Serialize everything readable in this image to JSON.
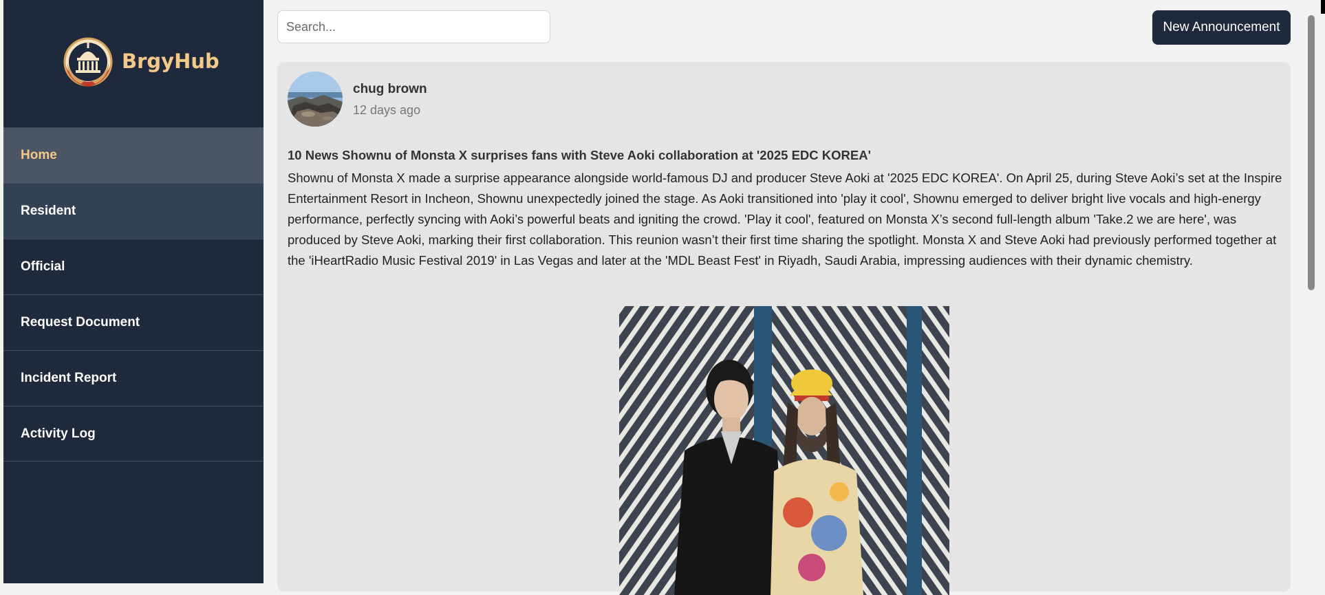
{
  "brand": {
    "name": "BrgyHub",
    "logo_icon": "capitol-building-logo-icon"
  },
  "sidebar": {
    "items": [
      {
        "label": "Home",
        "active": true
      },
      {
        "label": "Resident"
      },
      {
        "label": "Official"
      },
      {
        "label": "Request Document"
      },
      {
        "label": "Incident Report"
      },
      {
        "label": "Activity Log"
      }
    ]
  },
  "search": {
    "placeholder": "Search..."
  },
  "toolbar": {
    "new_announcement_label": "New Announcement"
  },
  "post": {
    "author": "chug brown",
    "time_ago": "12 days ago",
    "title": "10 News Shownu of Monsta X surprises fans with Steve Aoki collaboration at '2025 EDC KOREA'",
    "body": "Shownu of Monsta X made a surprise appearance alongside world-famous DJ and producer Steve Aoki at '2025 EDC KOREA'. On April 25, during Steve Aoki’s set at the Inspire Entertainment Resort in Incheon, Shownu unexpectedly joined the stage. As Aoki transitioned into 'play it cool', Shownu emerged to deliver bright live vocals and high-energy performance, perfectly syncing with Aoki’s powerful beats and igniting the crowd. 'Play it cool', featured on Monsta X’s second full-length album 'Take.2 we are here', was produced by Steve Aoki, marking their first collaboration. This reunion wasn’t their first time sharing the spotlight. Monsta X and Steve Aoki had previously performed together at the 'iHeartRadio Music Festival 2019' in Las Vegas and later at the 'MDL Beast Fest' in Riyadh, Saudi Arabia, impressing audiences with their dynamic chemistry."
  },
  "colors": {
    "sidebar_bg": "#1e293b",
    "accent_gold": "#f3c889",
    "active_item_bg": "#4b5563",
    "page_bg": "#f2f2f2",
    "card_bg": "#e5e5e5"
  }
}
